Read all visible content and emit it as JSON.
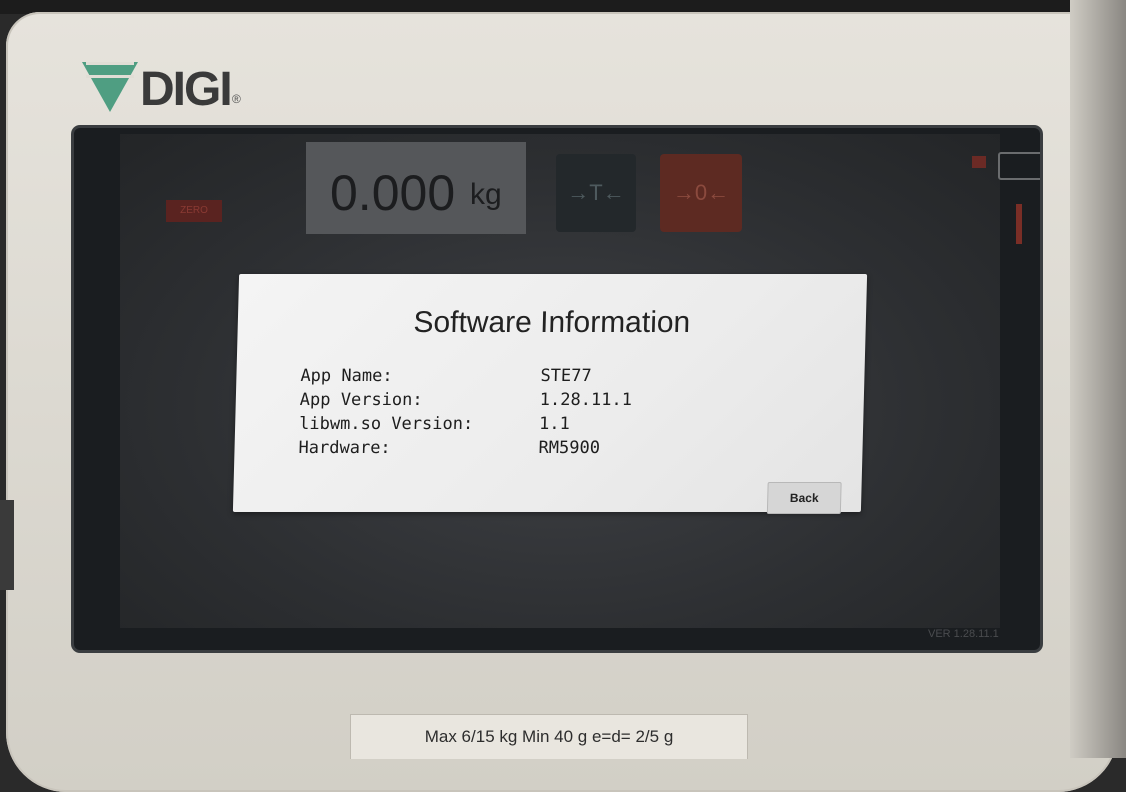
{
  "brand": {
    "logo_text": "DIGI",
    "logo_reg": "®"
  },
  "scale_display": {
    "zero_indicator": "ZERO",
    "weight_value": "0.000",
    "weight_unit": "kg",
    "tare_label": "→T←",
    "zero_label": "→0←",
    "version_tag": "VER 1.28.11.1"
  },
  "dialog": {
    "title": "Software Information",
    "rows": [
      {
        "label": "App Name:",
        "value": "STE77"
      },
      {
        "label": "App Version:",
        "value": "1.28.11.1"
      },
      {
        "label": "libwm.so Version:",
        "value": "1.1"
      },
      {
        "label": "Hardware:",
        "value": "RM5900"
      }
    ],
    "back_label": "Back"
  },
  "rating_plate": {
    "text": "Max 6/15 kg  Min 40 g  e=d= 2/5 g"
  },
  "colors": {
    "logo_green": "#4f9e82",
    "zero_red": "#5d2a22",
    "dialog_bg": "#f0f0f0"
  }
}
